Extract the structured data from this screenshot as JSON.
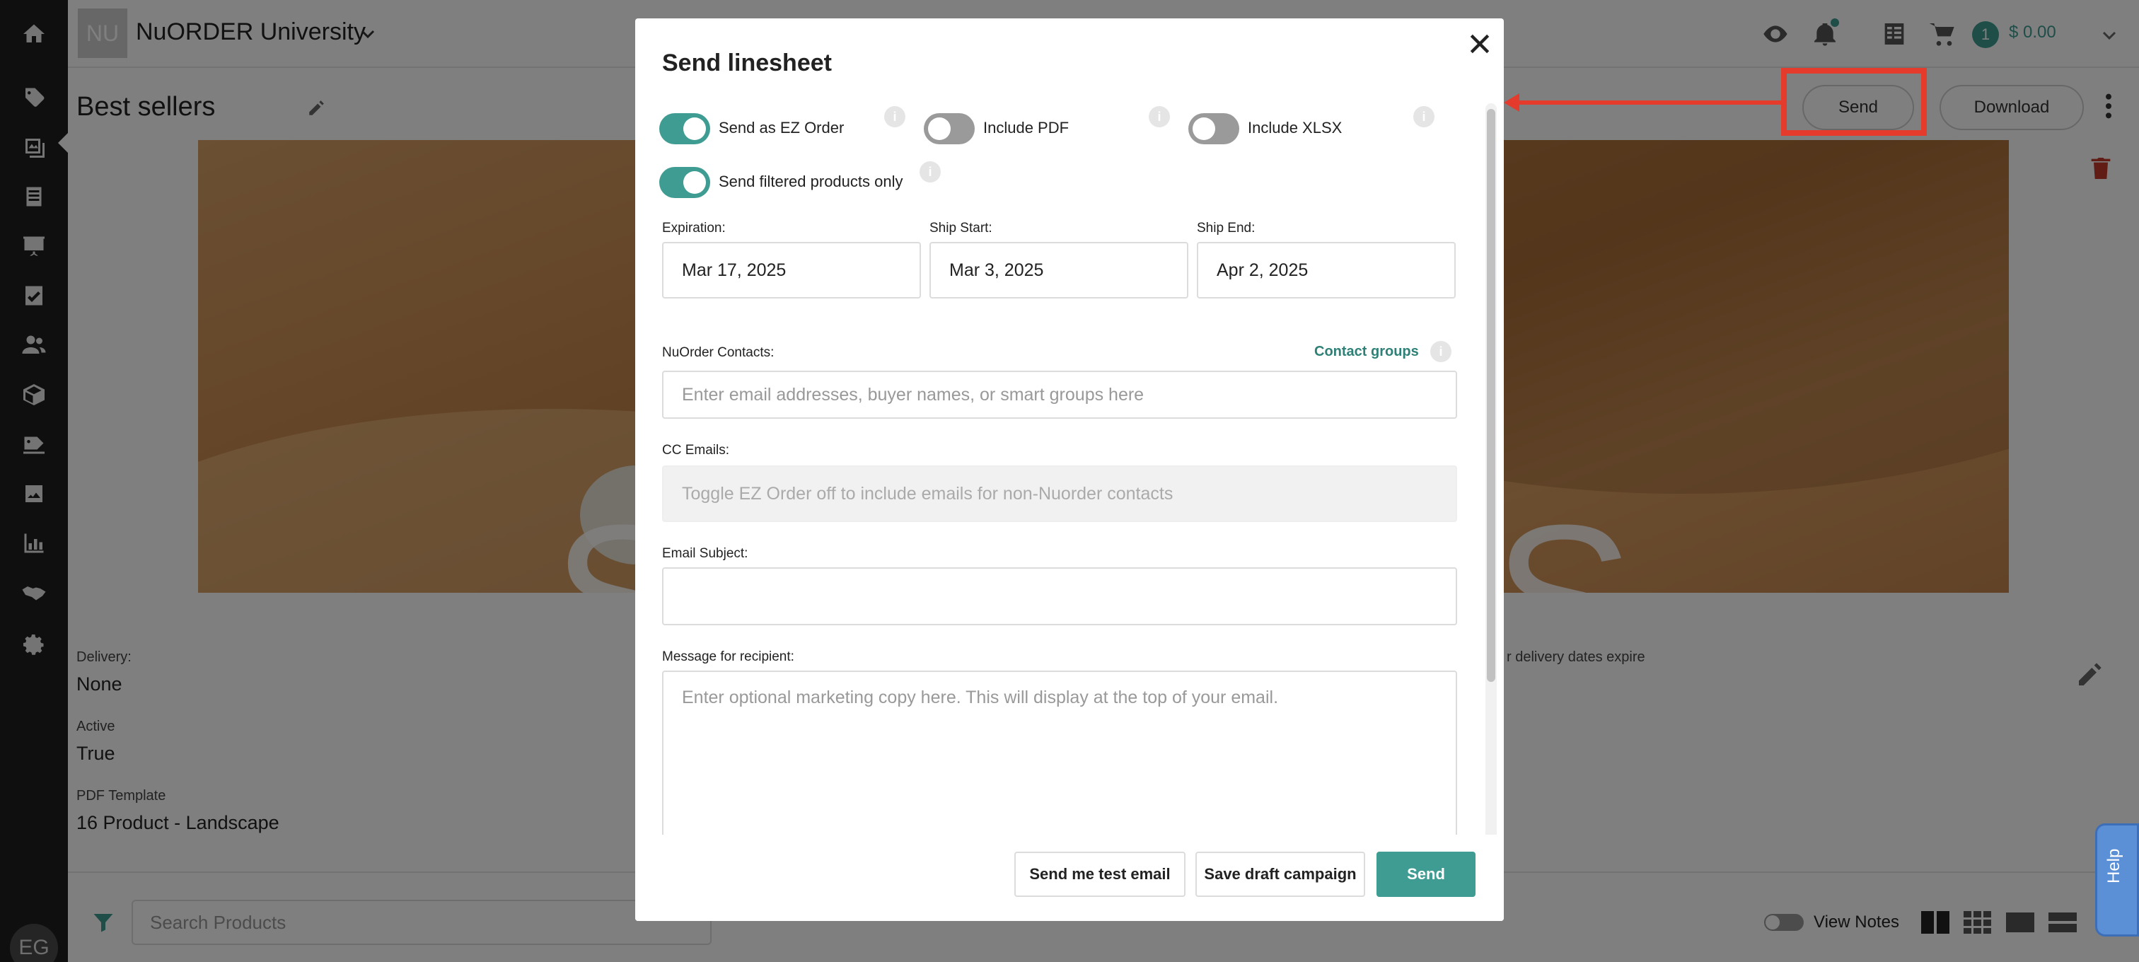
{
  "topbar": {
    "org_logo": "NU",
    "org_name": "NuORDER University",
    "cart_count": "1",
    "cart_total": "$ 0.00"
  },
  "sidebar": {
    "icons": [
      "home-icon",
      "tag-icon",
      "linesheet-icon",
      "catalog-icon",
      "presentation-icon",
      "checklist-icon",
      "buyers-icon",
      "box-icon",
      "discount-icon",
      "images-icon",
      "analytics-icon",
      "handshake-icon",
      "gear-icon"
    ],
    "avatar": "EG"
  },
  "page": {
    "title": "Best sellers",
    "send_label": "Send",
    "download_label": "Download",
    "hero_text": "BEST SELLERS",
    "delivery_label": "Delivery:",
    "delivery_value": "None",
    "active_label": "Active",
    "active_value": "True",
    "template_label": "PDF Template",
    "template_value": "16 Product - Landscape",
    "delivery_note": "r delivery dates expire",
    "search_placeholder": "Search Products",
    "view_notes_label": "View Notes"
  },
  "help": {
    "label": "Help"
  },
  "modal": {
    "title": "Send linesheet",
    "toggles": {
      "ez_order": {
        "label": "Send as EZ Order",
        "on": true
      },
      "include_pdf": {
        "label": "Include PDF",
        "on": false
      },
      "include_xlsx": {
        "label": "Include XLSX",
        "on": false
      },
      "filtered_only": {
        "label": "Send filtered products only",
        "on": true
      }
    },
    "expiration_label": "Expiration:",
    "expiration_value": "Mar 17, 2025",
    "ship_start_label": "Ship Start:",
    "ship_start_value": "Mar 3, 2025",
    "ship_end_label": "Ship End:",
    "ship_end_value": "Apr 2, 2025",
    "contacts_label": "NuOrder Contacts:",
    "contact_groups_label": "Contact groups",
    "contacts_placeholder": "Enter email addresses, buyer names, or smart groups here",
    "cc_label": "CC Emails:",
    "cc_placeholder": "Toggle EZ Order off to include emails for non-Nuorder contacts",
    "subject_label": "Email Subject:",
    "subject_value": "",
    "message_label": "Message for recipient:",
    "message_placeholder": "Enter optional marketing copy here. This will display at the top of your email.",
    "buttons": {
      "test_email": "Send me test email",
      "save_draft": "Save draft campaign",
      "send": "Send"
    }
  },
  "colors": {
    "accent": "#3f9c93",
    "annotation": "#e53b2c",
    "sidebar": "#1f1f1f"
  }
}
